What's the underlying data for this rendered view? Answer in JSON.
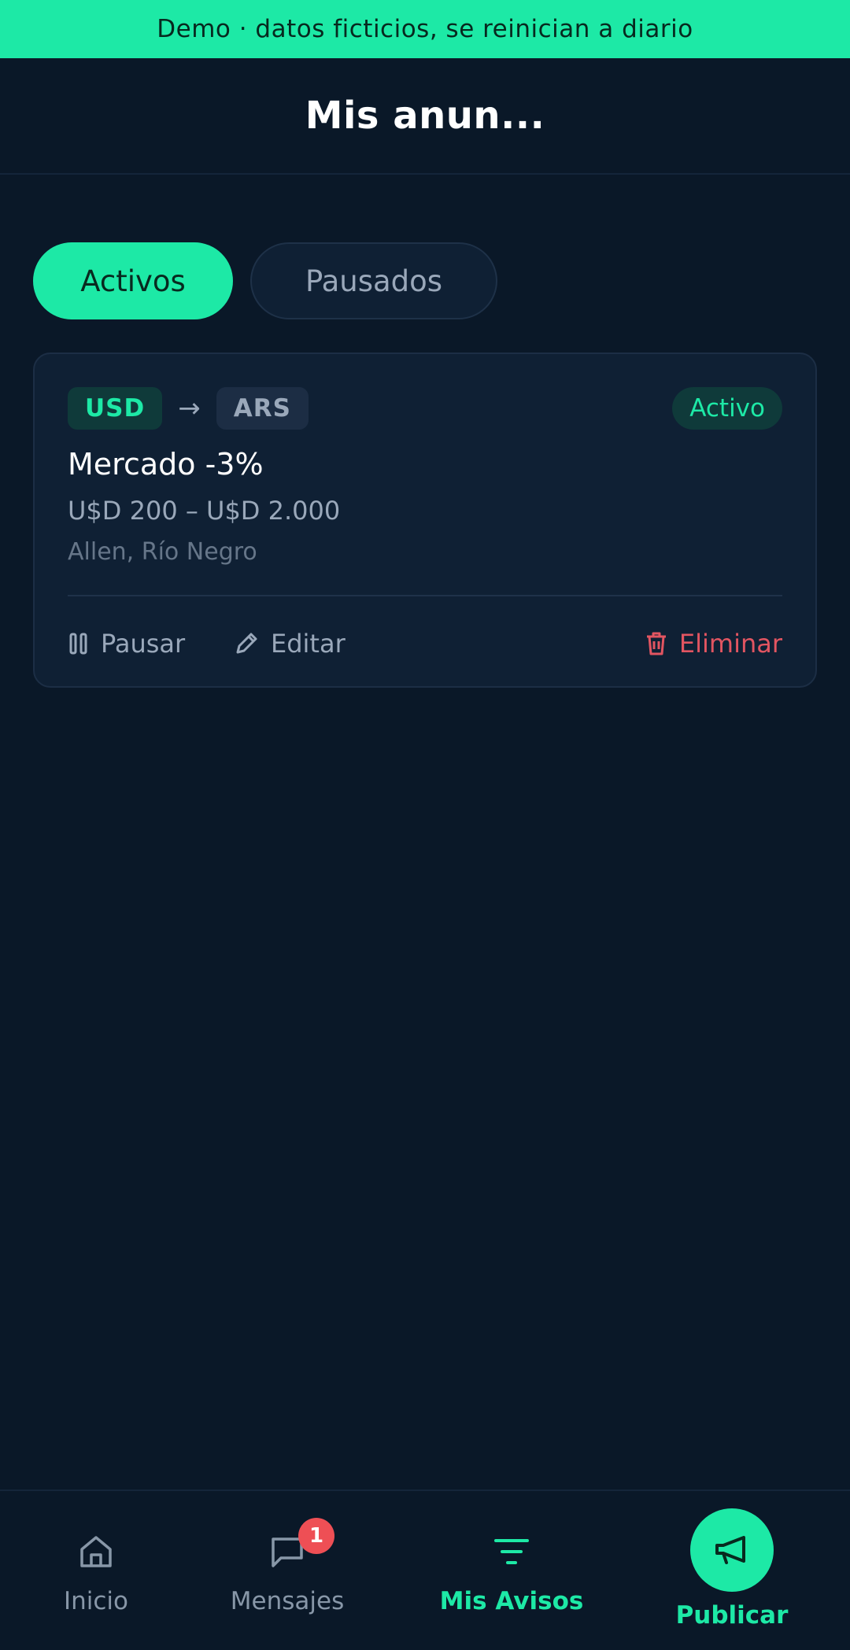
{
  "banner": {
    "text": "Demo · datos ficticios, se reinician a diario"
  },
  "header": {
    "title": "Mis anun..."
  },
  "tabs": [
    {
      "label": "Activos",
      "selected": true
    },
    {
      "label": "Pausados",
      "selected": false
    }
  ],
  "listing": {
    "from_currency": "USD",
    "arrow": "→",
    "to_currency": "ARS",
    "status": "Activo",
    "title": "Mercado -3%",
    "range": "U$D 200 – U$D 2.000",
    "location": "Allen, Río Negro",
    "actions": {
      "pause_label": "Pausar",
      "edit_label": "Editar",
      "delete_label": "Eliminar"
    }
  },
  "nav": {
    "items": [
      {
        "label": "Inicio",
        "icon": "home-icon"
      },
      {
        "label": "Mensajes",
        "icon": "chat-icon",
        "badge": "1"
      },
      {
        "label": "Mis Avisos",
        "icon": "filter-icon",
        "active": true
      },
      {
        "label": "Publicar",
        "icon": "megaphone-icon"
      }
    ]
  },
  "colors": {
    "accent": "#1de9a6",
    "background": "#0a1828",
    "card": "#0f2034",
    "danger": "#e25561",
    "badge": "#ee4f55"
  }
}
